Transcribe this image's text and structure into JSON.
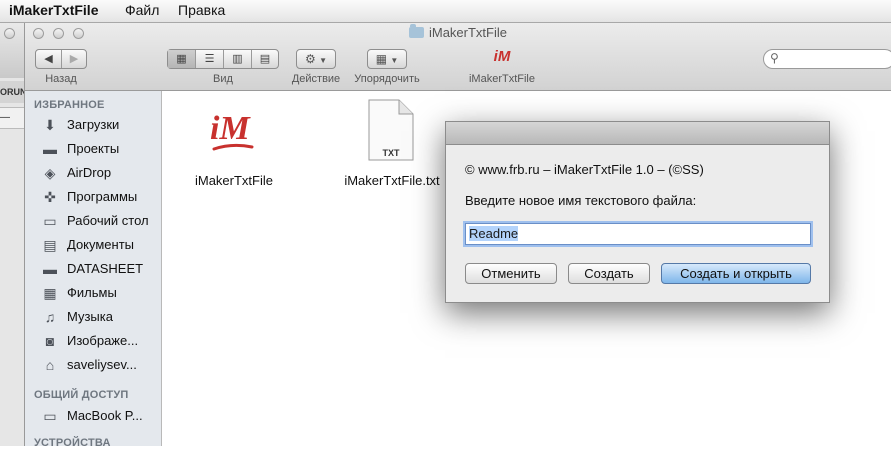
{
  "menubar": {
    "app": "iMakerTxtFile",
    "items": [
      "Файл",
      "Правка"
    ]
  },
  "background_window": {
    "fragment1": "ORUN",
    "fragment2": "—"
  },
  "window": {
    "title": "iMakerTxtFile"
  },
  "toolbar": {
    "back_label": "Назад",
    "view_label": "Вид",
    "action_label": "Действие",
    "arrange_label": "Упорядочить",
    "app_label": "iMakerTxtFile",
    "search_placeholder": ""
  },
  "sidebar": {
    "favorites_header": "ИЗБРАННОЕ",
    "favorites": [
      {
        "label": "Загрузки",
        "icon": "download-icon"
      },
      {
        "label": "Проекты",
        "icon": "folder-icon"
      },
      {
        "label": "AirDrop",
        "icon": "airdrop-icon"
      },
      {
        "label": "Программы",
        "icon": "applications-icon"
      },
      {
        "label": "Рабочий стол",
        "icon": "desktop-icon"
      },
      {
        "label": "Документы",
        "icon": "documents-icon"
      },
      {
        "label": "DATASHEET",
        "icon": "folder-icon"
      },
      {
        "label": "Фильмы",
        "icon": "movies-icon"
      },
      {
        "label": "Музыка",
        "icon": "music-icon"
      },
      {
        "label": "Изображе...",
        "icon": "pictures-icon"
      },
      {
        "label": "saveliysev...",
        "icon": "home-icon"
      }
    ],
    "shared_header": "ОБЩИЙ ДОСТУП",
    "shared": [
      {
        "label": "MacBook P...",
        "icon": "computer-icon"
      }
    ],
    "devices_header": "УСТРОЙСТВА"
  },
  "files": [
    {
      "name": "iMakerTxtFile",
      "kind": "app"
    },
    {
      "name": "iMakerTxtFile.txt",
      "kind": "txt",
      "badge": "TXT"
    }
  ],
  "dialog": {
    "copyright": "© www.frb.ru   –   iMakerTxtFile 1.0 – (©SS)",
    "prompt": "Введите новое имя текстового файла:",
    "input_value": "Readme",
    "cancel_label": "Отменить",
    "create_label": "Создать",
    "create_open_label": "Создать и открыть"
  },
  "colors": {
    "sidebar_bg": "#e4e8ed",
    "default_button": "#7fb6ea",
    "app_logo": "#c8312e"
  }
}
